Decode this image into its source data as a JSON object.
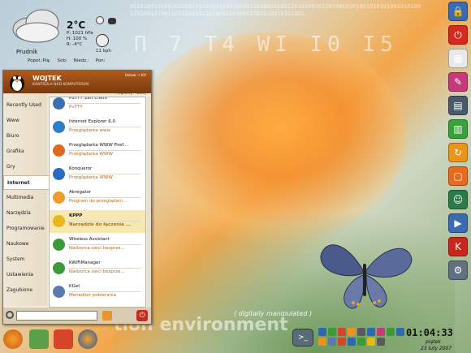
{
  "weather": {
    "temp": "2°C",
    "details": [
      "P: 1021 hPa",
      "H: 100 %",
      "R: -4°C"
    ],
    "wind": "11 kph",
    "city": "Prudnik",
    "forecast": [
      "Popoł.:Pią:",
      "Sob:",
      "Niedz.:",
      "Pon:"
    ]
  },
  "menu": {
    "user": "WOJTEK",
    "user_sub": "KONTROLA NAD KOMPUTEREM",
    "header_right": "Ustaw. • KV",
    "header_right2": "Programy • Dalej",
    "categories": [
      {
        "label": "Recently Used",
        "selected": false
      },
      {
        "label": "Www",
        "selected": false
      },
      {
        "label": "Biuro",
        "selected": false
      },
      {
        "label": "Grafika",
        "selected": false
      },
      {
        "label": "Gry",
        "selected": false
      },
      {
        "label": "Internet",
        "selected": true
      },
      {
        "label": "Multimedia",
        "selected": false
      },
      {
        "label": "Narzędzia",
        "selected": false
      },
      {
        "label": "Programowanie",
        "selected": false
      },
      {
        "label": "Naukowe",
        "selected": false
      },
      {
        "label": "System",
        "selected": false
      },
      {
        "label": "Ustawienia",
        "selected": false
      },
      {
        "label": "Zagubione",
        "selected": false
      }
    ],
    "apps": [
      {
        "name": "PuTTY SSH Client",
        "desc": "PuTTY",
        "color": "#3a6fb0",
        "selected": false
      },
      {
        "name": "Internet Explorer 6.0",
        "desc": "Przeglądarka www",
        "color": "#2e7ec9",
        "selected": false
      },
      {
        "name": "Przeglądarka WWW Firef...",
        "desc": "Przeglądarka WWW",
        "color": "#e06a1c",
        "selected": false
      },
      {
        "name": "Konqueror",
        "desc": "Przeglądarka WWW",
        "color": "#2a6ac0",
        "selected": false
      },
      {
        "name": "Akregator",
        "desc": "Program do przeglądani...",
        "color": "#f09a2a",
        "selected": false
      },
      {
        "name": "KPPP",
        "desc": "Narzędzie do łączenia ...",
        "color": "#e8b71a",
        "selected": true
      },
      {
        "name": "Wireless Assistant",
        "desc": "Nadzorca sieci bezprze...",
        "color": "#3a9a3a",
        "selected": false
      },
      {
        "name": "KWiFiManager",
        "desc": "Nadzorca sieci bezprze...",
        "color": "#3a9a3a",
        "selected": false
      },
      {
        "name": "KGet",
        "desc": "Menedżer pobierania",
        "color": "#5a7ab0",
        "selected": false
      }
    ],
    "search_value": ""
  },
  "right_panel": [
    {
      "icon": "lock-icon",
      "color": "#3a6bb0",
      "glyph": "🔒"
    },
    {
      "icon": "logout-icon",
      "color": "#d6281c",
      "glyph": "⏻"
    },
    {
      "icon": "calculator-icon",
      "color": "#e8e8e8",
      "glyph": "▦"
    },
    {
      "icon": "text-editor-icon",
      "color": "#c63a7a",
      "glyph": "✎"
    },
    {
      "icon": "file-manager-icon",
      "color": "#4a5a6a",
      "glyph": "▤"
    },
    {
      "icon": "spreadsheet-icon",
      "color": "#3aa03a",
      "glyph": "▥"
    },
    {
      "icon": "refresh-icon",
      "color": "#e8951a",
      "glyph": "↻"
    },
    {
      "icon": "presentation-icon",
      "color": "#e86a1c",
      "glyph": "▢"
    },
    {
      "icon": "spy-icon",
      "color": "#2a7a4a",
      "glyph": "☺"
    },
    {
      "icon": "mplayer-icon",
      "color": "#3a6ab0",
      "glyph": "▶"
    },
    {
      "icon": "office-icon",
      "color": "#c8281c",
      "glyph": "K"
    },
    {
      "icon": "tools-icon",
      "color": "#607080",
      "glyph": "⚙"
    }
  ],
  "taskbar": {
    "clock": "01:04:33",
    "day": "piątek",
    "date": "23 luty 2007",
    "watermark": "tion environment",
    "manipulated": "( digitally manipulated )"
  },
  "background": {
    "deco": "Π 7 T4 WI I0 I5"
  }
}
